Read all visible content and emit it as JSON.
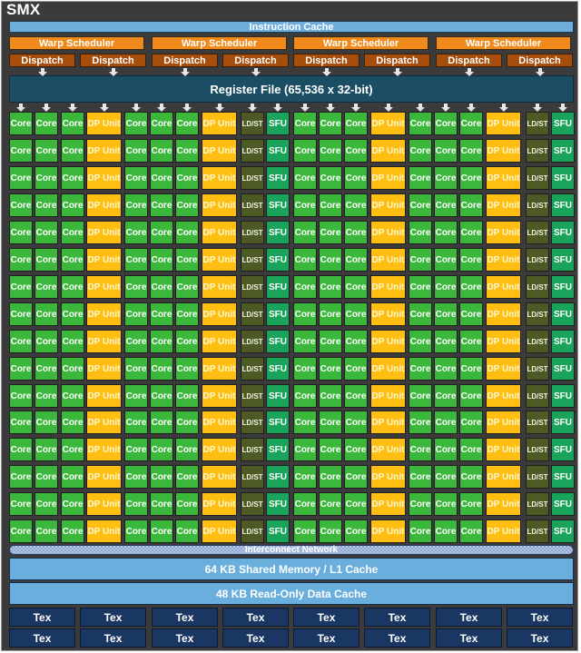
{
  "title": "SMX",
  "instruction_cache": "Instruction Cache",
  "warp_schedulers": [
    "Warp Scheduler",
    "Warp Scheduler",
    "Warp Scheduler",
    "Warp Scheduler"
  ],
  "dispatch_units": [
    "Dispatch",
    "Dispatch",
    "Dispatch",
    "Dispatch",
    "Dispatch",
    "Dispatch",
    "Dispatch",
    "Dispatch"
  ],
  "register_file": "Register File (65,536 x 32-bit)",
  "unit_row_pattern": [
    "Core",
    "Core",
    "Core",
    "DP Unit",
    "Core",
    "Core",
    "Core",
    "DP Unit",
    "LD/ST",
    "SFU",
    "Core",
    "Core",
    "Core",
    "DP Unit",
    "Core",
    "Core",
    "Core",
    "DP Unit",
    "LD/ST",
    "SFU"
  ],
  "unit_row_count": 16,
  "labels": {
    "core": "Core",
    "dp": "DP Unit",
    "ldst": "LD/ST",
    "sfu": "SFU"
  },
  "interconnect": "Interconnect Network",
  "shared_memory": "64 KB Shared Memory / L1 Cache",
  "readonly_cache": "48 KB Read-Only Data Cache",
  "tex_units": [
    [
      "Tex",
      "Tex",
      "Tex",
      "Tex",
      "Tex",
      "Tex",
      "Tex",
      "Tex"
    ],
    [
      "Tex",
      "Tex",
      "Tex",
      "Tex",
      "Tex",
      "Tex",
      "Tex",
      "Tex"
    ]
  ],
  "colors": {
    "core": "#3bb83b",
    "dp_unit": "#ffbf12",
    "ldst": "#4d5a25",
    "sfu": "#1aa35a",
    "warp_scheduler": "#f08a1c",
    "dispatch": "#a84e0c",
    "register_file": "#1b4e64",
    "cache": "#6aaedd",
    "tex": "#1a3662"
  }
}
